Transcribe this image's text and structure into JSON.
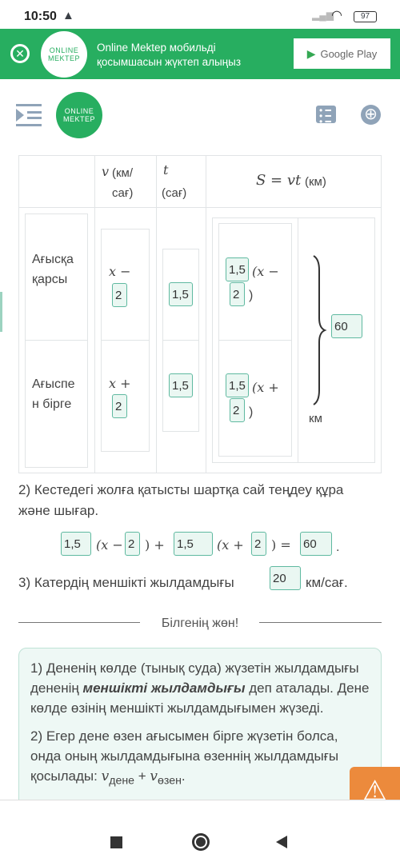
{
  "status": {
    "time": "10:50",
    "battery": "97"
  },
  "banner": {
    "logo_line1": "ONLINE",
    "logo_line2": "MEKTEP",
    "text_line1": "Online Mektep мобильді",
    "text_line2": "қосымшасын жүктеп алыңыз",
    "store_label": "Google Play"
  },
  "header": {
    "logo_line1": "ONLINE",
    "logo_line2": "MEKTEP"
  },
  "table": {
    "headers": {
      "v_var": "v",
      "v_unit": "(км/ сағ)",
      "t_var": "t",
      "t_unit": "(сағ)",
      "s_formula": "S = vt",
      "s_unit": "(км)"
    },
    "rows": [
      {
        "label": "Ағысқа қарсы",
        "v_expr": "x −",
        "v_value": "2",
        "t_value": "1,5",
        "s_coef": "1,5",
        "s_expr": "(x −",
        "s_value": "2",
        "s_close": ")"
      },
      {
        "label": "Ағыспен бірге",
        "v_expr": "x +",
        "v_value": "2",
        "t_value": "1,5",
        "s_coef": "1,5",
        "s_expr": "(x +",
        "s_value": "2",
        "s_close": ")"
      }
    ],
    "total": "60",
    "total_unit": "км"
  },
  "task2": {
    "text": "2) Кестедегі жолға қатысты шартқа сай теңдеу құра және шығар.",
    "c1": "1,5",
    "e1": "(x −",
    "c2": "2",
    "e2": ") +",
    "c3": "1,5",
    "e3": "(x +",
    "c4": "2",
    "e4": ") =",
    "c5": "60",
    "end": "."
  },
  "task3": {
    "text": "3) Катердің меншікті жылдамдығы",
    "answer": "20",
    "unit": "км/сағ."
  },
  "divider": "Білгенің жөн!",
  "info": {
    "p1_a": "1) Дененің көлде (тынық суда) жүзетін жылдамдығы дененің ",
    "p1_bold": "меншікті жылдамдығы",
    "p1_b": " деп аталады. Дене көлде өзінің меншікті жылдамдығымен жүзеді.",
    "p2": "2) Егер дене өзен ағысымен бірге жүзетін болса, онда оның жылдамдығына өзеннің жылдамдығы қосылады: ",
    "p2_m1": "v",
    "p2_s1": "дене",
    "p2_plus": " + ",
    "p2_m2": "v",
    "p2_s2": "өзен",
    "p2_end": "."
  },
  "colors": {
    "brand": "#27ae60",
    "chip_border": "#5fb9a0",
    "warning": "#ec8a3c"
  }
}
